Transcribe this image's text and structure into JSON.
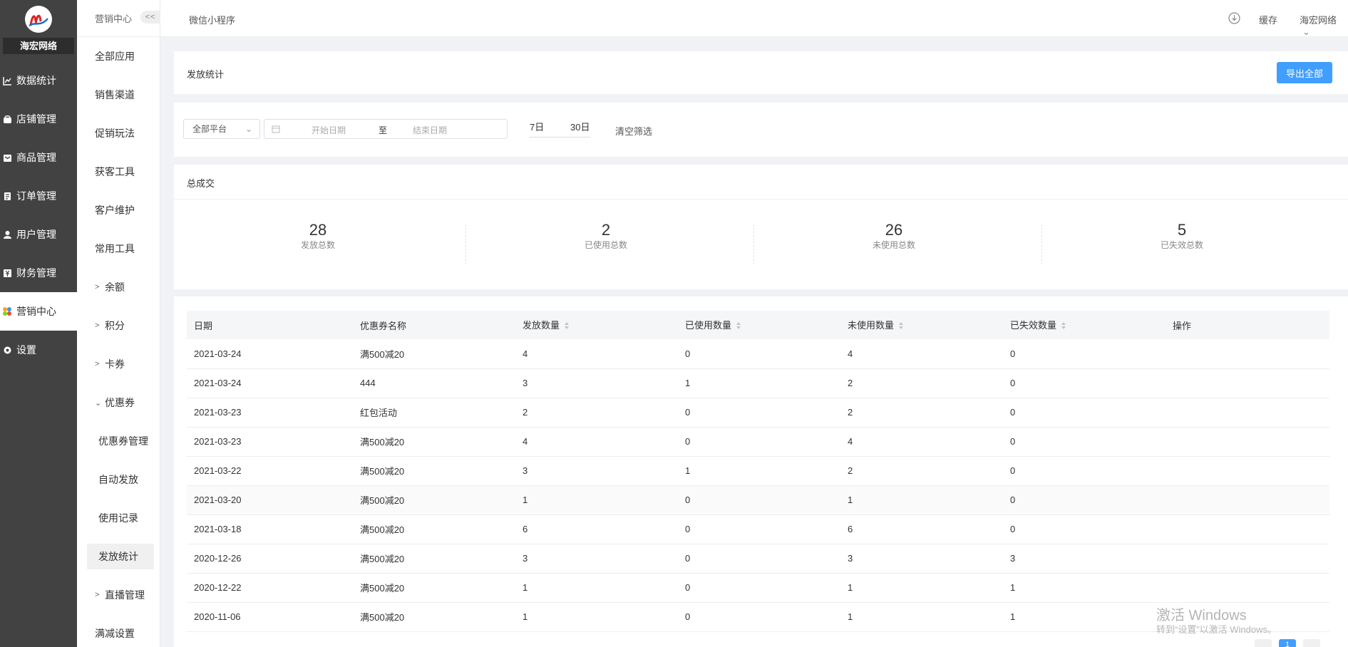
{
  "brand": {
    "name": "海宏网络"
  },
  "nav_main": [
    {
      "label": "数据统计",
      "icon": "chart-icon"
    },
    {
      "label": "店铺管理",
      "icon": "store-icon"
    },
    {
      "label": "商品管理",
      "icon": "goods-icon"
    },
    {
      "label": "订单管理",
      "icon": "order-icon"
    },
    {
      "label": "用户管理",
      "icon": "user-icon"
    },
    {
      "label": "财务管理",
      "icon": "finance-icon"
    },
    {
      "label": "营销中心",
      "icon": "marketing-icon",
      "active": true
    },
    {
      "label": "设置",
      "icon": "settings-icon"
    }
  ],
  "nav_sub": {
    "header": "营销中心",
    "collapse_label": "<<",
    "items": [
      {
        "label": "全部应用"
      },
      {
        "label": "销售渠道"
      },
      {
        "label": "促销玩法"
      },
      {
        "label": "获客工具"
      },
      {
        "label": "客户维护"
      },
      {
        "label": "常用工具"
      },
      {
        "label": "余额"
      },
      {
        "label": "积分"
      },
      {
        "label": "卡券"
      },
      {
        "label": "优惠券"
      },
      {
        "label": "优惠券管理"
      },
      {
        "label": "自动发放"
      },
      {
        "label": "使用记录"
      },
      {
        "label": "发放统计"
      },
      {
        "label": "直播管理"
      },
      {
        "label": "满减设置"
      }
    ]
  },
  "topbar": {
    "breadcrumb": "微信小程序",
    "cache_label": "缓存",
    "user_label": "海宏网络"
  },
  "header_card": {
    "title": "发放统计",
    "export_label": "导出全部"
  },
  "filters": {
    "platform": "全部平台",
    "start_placeholder": "开始日期",
    "range_separator": "至",
    "end_placeholder": "结束日期",
    "quick_7": "7日",
    "quick_30": "30日",
    "clear_label": "清空筛选"
  },
  "summary": {
    "title": "总成交",
    "stats": [
      {
        "value": "28",
        "label": "发放总数"
      },
      {
        "value": "2",
        "label": "已使用总数"
      },
      {
        "value": "26",
        "label": "未使用总数"
      },
      {
        "value": "5",
        "label": "已失效总数"
      }
    ]
  },
  "table": {
    "headers": [
      "日期",
      "优惠券名称",
      "发放数量",
      "已使用数量",
      "未使用数量",
      "已失效数量",
      "操作"
    ],
    "rows": [
      [
        "2021-03-24",
        "满500减20",
        "4",
        "0",
        "4",
        "0"
      ],
      [
        "2021-03-24",
        "444",
        "3",
        "1",
        "2",
        "0"
      ],
      [
        "2021-03-23",
        "红包活动",
        "2",
        "0",
        "2",
        "0"
      ],
      [
        "2021-03-23",
        "满500减20",
        "4",
        "0",
        "4",
        "0"
      ],
      [
        "2021-03-22",
        "满500减20",
        "3",
        "1",
        "2",
        "0"
      ],
      [
        "2021-03-20",
        "满500减20",
        "1",
        "0",
        "1",
        "0"
      ],
      [
        "2021-03-18",
        "满500减20",
        "6",
        "0",
        "6",
        "0"
      ],
      [
        "2020-12-26",
        "满500减20",
        "3",
        "0",
        "3",
        "3"
      ],
      [
        "2020-12-22",
        "满500减20",
        "1",
        "0",
        "1",
        "1"
      ],
      [
        "2020-11-06",
        "满500减20",
        "1",
        "0",
        "1",
        "1"
      ]
    ]
  },
  "watermark": {
    "line1": "激活 Windows",
    "line2": "转到“设置”以激活 Windows。"
  },
  "pager": {
    "current": "1"
  }
}
